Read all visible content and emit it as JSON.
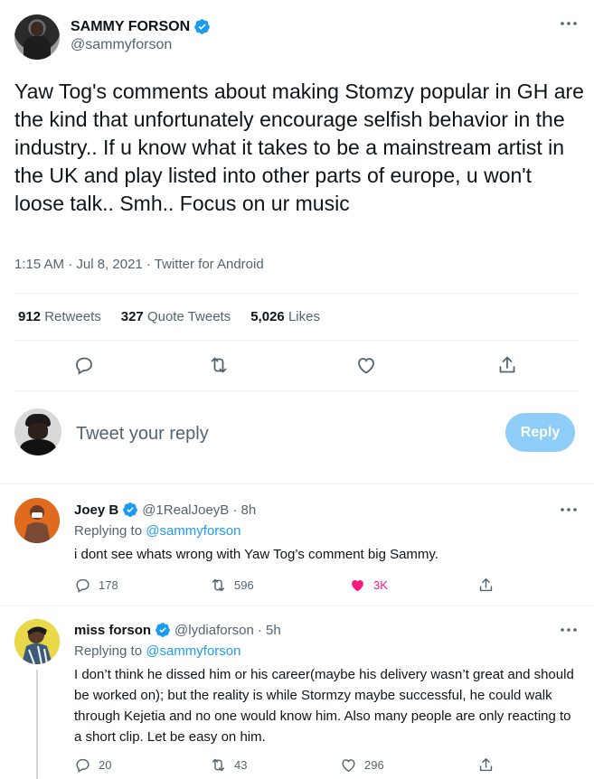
{
  "main_tweet": {
    "author_name": "SAMMY FORSON",
    "handle": "@sammyforson",
    "text": "Yaw Tog's comments about making Stomzy popular in GH are the kind that unfortunately encourage selfish behavior in the industry.. If u know what it takes to be a mainstream artist in the UK and play listed into other parts of europe, u won't loose talk.. Smh.. Focus on ur music",
    "timestamp": "1:15 AM · Jul 8, 2021 · Twitter for Android",
    "stats": {
      "retweets_count": "912",
      "retweets_label": "Retweets",
      "quotes_count": "327",
      "quotes_label": "Quote Tweets",
      "likes_count": "5,026",
      "likes_label": "Likes"
    }
  },
  "reply_box": {
    "placeholder": "Tweet your reply",
    "button_label": "Reply"
  },
  "replies": [
    {
      "name": "Joey B",
      "handle": "@1RealJoeyB",
      "time": "· 8h",
      "replying_prefix": "Replying to",
      "replying_to": "@sammyforson",
      "text": "i dont see whats wrong with Yaw Tog’s comment big Sammy.",
      "replies": "178",
      "retweets": "596",
      "likes": "3K"
    },
    {
      "name": "miss forson",
      "handle": "@lydiaforson",
      "time": "· 5h",
      "replying_prefix": "Replying to",
      "replying_to": "@sammyforson",
      "text": "I don’t think he dissed him or his career(maybe his delivery wasn’t great and should be worked on); but the reality is while Stormzy maybe successful, he could walk through Kejetia and no one would know him. Also many people are only reacting to a short clip. Let be easy on him.",
      "replies": "20",
      "retweets": "43",
      "likes": "296"
    }
  ],
  "colors": {
    "accent": "#1d9bf0",
    "like": "#f91880",
    "muted": "#536471",
    "text": "#0f1419",
    "reply_button": "#8ecdf8"
  },
  "icons": [
    "verified-badge-icon",
    "more-icon",
    "reply-icon",
    "retweet-icon",
    "like-icon",
    "share-icon"
  ]
}
